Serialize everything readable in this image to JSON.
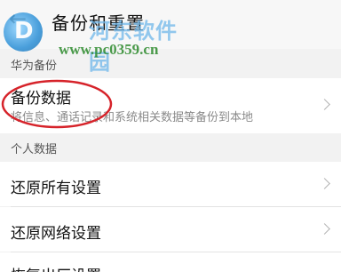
{
  "header": {
    "back_icon": "back-arrow-icon",
    "title": "备份和重置"
  },
  "watermark": {
    "site_name": "河东软件园",
    "url": "www.pc0359.cn"
  },
  "sections": {
    "huawei_backup": {
      "label": "华为备份"
    },
    "personal_data": {
      "label": "个人数据"
    }
  },
  "rows": {
    "backup_data": {
      "title": "备份数据",
      "subtitle": "将信息、通话记录和系统相关数据等备份到本地"
    },
    "restore_all": {
      "title": "还原所有设置"
    },
    "restore_network": {
      "title": "还原网络设置"
    },
    "factory_reset": {
      "title": "恢复出厂设置"
    }
  },
  "colors": {
    "highlight": "#d6232a",
    "background": "#f2f2f2",
    "row_background": "#ffffff"
  }
}
